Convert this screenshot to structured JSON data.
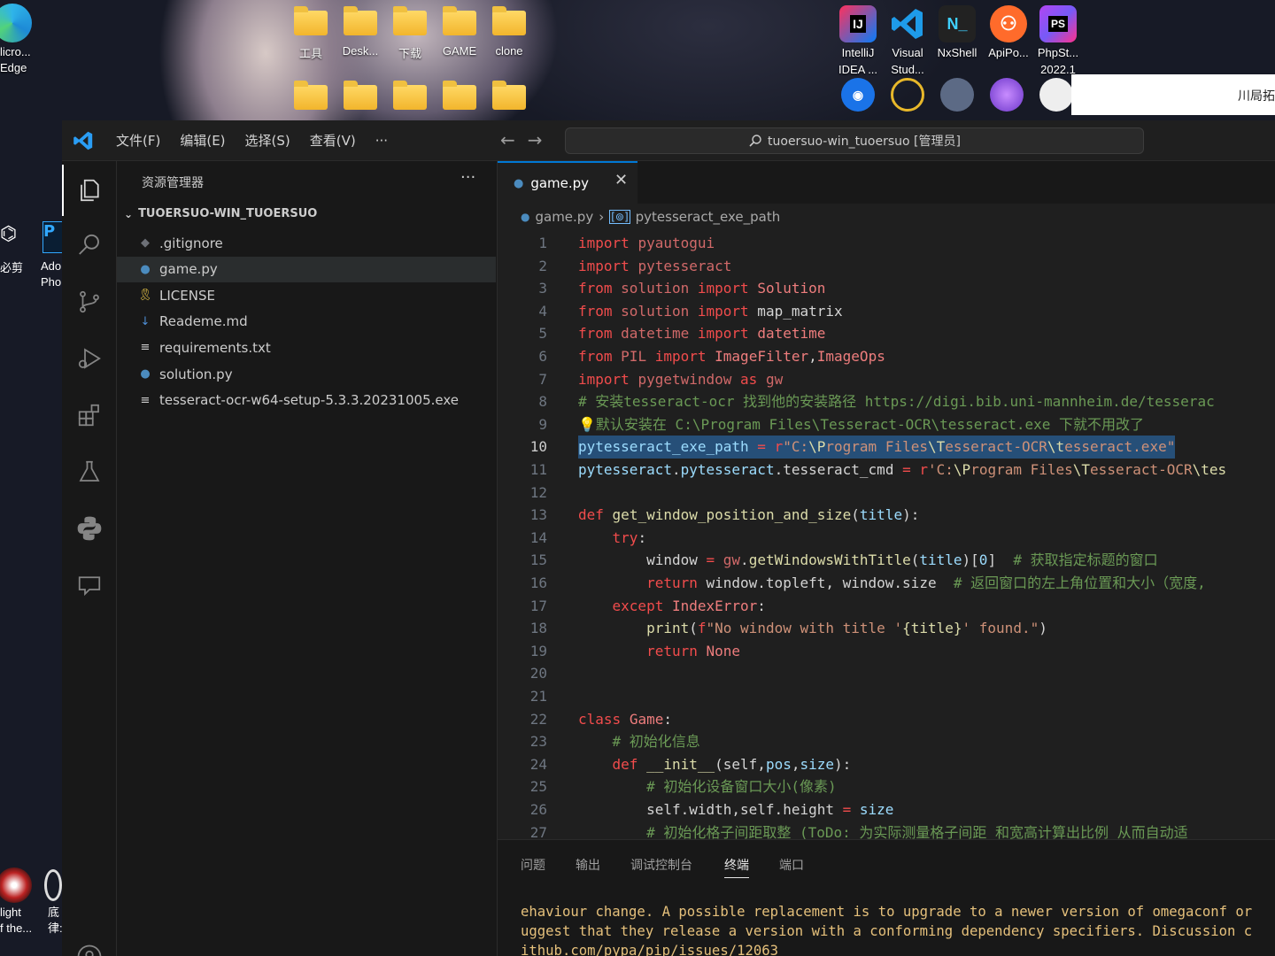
{
  "desktop": {
    "left_icons": [
      {
        "label1": "licro...",
        "label2": "Edge",
        "icon": "edge-icon"
      },
      {
        "label1": "必剪",
        "icon": "bijian-icon"
      },
      {
        "label1": "Ado",
        "label2": "Pho",
        "icon": "photoshop-icon"
      },
      {
        "label1": "light",
        "label2": "f the...",
        "icon": "game-icon"
      },
      {
        "label1": "底",
        "label2": "律:",
        "icon": "app-icon"
      }
    ],
    "folders_row1": [
      "工具",
      "Desk...",
      "下载",
      "GAME",
      "clone"
    ],
    "apps": [
      {
        "label1": "IntelliJ",
        "label2": "IDEA ...",
        "icon": "intellij-icon",
        "text": "IJ"
      },
      {
        "label1": "Visual",
        "label2": "Stud...",
        "icon": "visual-studio-icon",
        "text": ""
      },
      {
        "label1": "NxShell",
        "label2": "",
        "icon": "nxshell-icon",
        "text": "N_"
      },
      {
        "label1": "ApiPo...",
        "label2": "",
        "icon": "apipost-icon",
        "text": ""
      },
      {
        "label1": "PhpSt...",
        "label2": "2022.1",
        "icon": "phpstorm-icon",
        "text": "PS"
      }
    ],
    "notification_text": "川局拓"
  },
  "titlebar": {
    "menus": [
      "文件(F)",
      "编辑(E)",
      "选择(S)",
      "查看(V)",
      "···"
    ],
    "command_center": "tuoersuo-win_tuoersuo [管理员]"
  },
  "sidebar": {
    "title": "资源管理器",
    "more": "···",
    "project": "TUOERSUO-WIN_TUOERSUO",
    "files": [
      {
        "name": ".gitignore",
        "icon": "git-icon",
        "color": "#6d7077",
        "glyph": "◆"
      },
      {
        "name": "game.py",
        "icon": "python-icon",
        "color": "#4b8bbe",
        "glyph": "●",
        "selected": true
      },
      {
        "name": "LICENSE",
        "icon": "license-icon",
        "color": "#e8c547",
        "glyph": "🎗"
      },
      {
        "name": "Reademe.md",
        "icon": "markdown-icon",
        "color": "#4f8fd6",
        "glyph": "↓"
      },
      {
        "name": "requirements.txt",
        "icon": "text-file-icon",
        "color": "#cccccc",
        "glyph": "≡"
      },
      {
        "name": "solution.py",
        "icon": "python-icon",
        "color": "#4b8bbe",
        "glyph": "●"
      },
      {
        "name": "tesseract-ocr-w64-setup-5.3.3.20231005.exe",
        "icon": "text-file-icon",
        "color": "#cccccc",
        "glyph": "≡"
      }
    ]
  },
  "editor": {
    "tab": "game.py",
    "breadcrumb_file": "game.py",
    "breadcrumb_symbol": "pytesseract_exe_path",
    "current_line": 10,
    "lines": [
      {
        "n": "1",
        "seg": [
          [
            "kw",
            "import"
          ],
          [
            "pl",
            " "
          ],
          [
            "mod",
            "pyautogui"
          ]
        ]
      },
      {
        "n": "2",
        "seg": [
          [
            "kw",
            "import"
          ],
          [
            "pl",
            " "
          ],
          [
            "mod",
            "pytesseract"
          ]
        ]
      },
      {
        "n": "3",
        "seg": [
          [
            "kw",
            "from"
          ],
          [
            "pl",
            " "
          ],
          [
            "mod",
            "solution"
          ],
          [
            "pl",
            " "
          ],
          [
            "kw",
            "import"
          ],
          [
            "pl",
            " "
          ],
          [
            "cls",
            "Solution"
          ]
        ]
      },
      {
        "n": "4",
        "seg": [
          [
            "kw",
            "from"
          ],
          [
            "pl",
            " "
          ],
          [
            "mod",
            "solution"
          ],
          [
            "pl",
            " "
          ],
          [
            "kw",
            "import"
          ],
          [
            "pl",
            " map_matrix"
          ]
        ]
      },
      {
        "n": "5",
        "seg": [
          [
            "kw",
            "from"
          ],
          [
            "pl",
            " "
          ],
          [
            "mod",
            "datetime"
          ],
          [
            "pl",
            " "
          ],
          [
            "kw",
            "import"
          ],
          [
            "pl",
            " "
          ],
          [
            "cls",
            "datetime"
          ]
        ]
      },
      {
        "n": "6",
        "seg": [
          [
            "kw",
            "from"
          ],
          [
            "pl",
            " "
          ],
          [
            "mod",
            "PIL"
          ],
          [
            "pl",
            " "
          ],
          [
            "kw",
            "import"
          ],
          [
            "pl",
            " "
          ],
          [
            "cls",
            "ImageFilter"
          ],
          [
            "pl",
            ","
          ],
          [
            "cls",
            "ImageOps"
          ]
        ]
      },
      {
        "n": "7",
        "seg": [
          [
            "kw",
            "import"
          ],
          [
            "pl",
            " "
          ],
          [
            "mod",
            "pygetwindow"
          ],
          [
            "pl",
            " "
          ],
          [
            "kw",
            "as"
          ],
          [
            "pl",
            " "
          ],
          [
            "mod",
            "gw"
          ]
        ]
      },
      {
        "n": "8",
        "seg": [
          [
            "cm",
            "# 安装tesseract-ocr 找到他的安装路径 https://digi.bib.uni-mannheim.de/tesserac"
          ]
        ]
      },
      {
        "n": "9",
        "seg": [
          [
            "fn",
            "💡"
          ],
          [
            "cm",
            "默认安装在 C:\\Program Files\\Tesseract-OCR\\tesseract.exe 下就不用改了"
          ]
        ]
      },
      {
        "n": "10",
        "seg": [
          [
            "var",
            "pytesseract_exe_path"
          ],
          [
            "pl",
            " "
          ],
          [
            "kw",
            "="
          ],
          [
            "pl",
            " "
          ],
          [
            "kw",
            "r"
          ],
          [
            "str",
            "\"C:"
          ],
          [
            "fn",
            "\\P"
          ],
          [
            "str",
            "rogram Files"
          ],
          [
            "fn",
            "\\T"
          ],
          [
            "str",
            "esseract-OCR"
          ],
          [
            "fn",
            "\\t"
          ],
          [
            "str",
            "esseract.exe\""
          ]
        ]
      },
      {
        "n": "11",
        "seg": [
          [
            "var",
            "pytesseract"
          ],
          [
            "pl",
            "."
          ],
          [
            "var",
            "pytesseract"
          ],
          [
            "pl",
            "."
          ],
          [
            "pl",
            "tesseract_cmd"
          ],
          [
            "pl",
            " "
          ],
          [
            "kw",
            "="
          ],
          [
            "pl",
            " "
          ],
          [
            "kw",
            "r"
          ],
          [
            "str",
            "'C:"
          ],
          [
            "fn",
            "\\P"
          ],
          [
            "str",
            "rogram Files"
          ],
          [
            "fn",
            "\\T"
          ],
          [
            "str",
            "esseract-OCR"
          ],
          [
            "fn",
            "\\tes"
          ]
        ]
      },
      {
        "n": "12",
        "seg": []
      },
      {
        "n": "13",
        "seg": [
          [
            "kw",
            "def"
          ],
          [
            "pl",
            " "
          ],
          [
            "fn",
            "get_window_position_and_size"
          ],
          [
            "pl",
            "("
          ],
          [
            "var",
            "title"
          ],
          [
            "pl",
            "):"
          ]
        ]
      },
      {
        "n": "14",
        "seg": [
          [
            "pl",
            "    "
          ],
          [
            "kw",
            "try"
          ],
          [
            "pl",
            ":"
          ]
        ]
      },
      {
        "n": "15",
        "seg": [
          [
            "pl",
            "        window "
          ],
          [
            "kw",
            "="
          ],
          [
            "pl",
            " "
          ],
          [
            "mod",
            "gw"
          ],
          [
            "pl",
            "."
          ],
          [
            "fn",
            "getWindowsWithTitle"
          ],
          [
            "pl",
            "("
          ],
          [
            "var",
            "title"
          ],
          [
            "pl",
            ")["
          ],
          [
            "var",
            "0"
          ],
          [
            "pl",
            "]  "
          ],
          [
            "cm",
            "# 获取指定标题的窗口"
          ]
        ]
      },
      {
        "n": "16",
        "seg": [
          [
            "pl",
            "        "
          ],
          [
            "kw",
            "return"
          ],
          [
            "pl",
            " window.topleft, window.size  "
          ],
          [
            "cm",
            "# 返回窗口的左上角位置和大小（宽度,"
          ]
        ]
      },
      {
        "n": "17",
        "seg": [
          [
            "pl",
            "    "
          ],
          [
            "kw",
            "except"
          ],
          [
            "pl",
            " "
          ],
          [
            "cls",
            "IndexError"
          ],
          [
            "pl",
            ":"
          ]
        ]
      },
      {
        "n": "18",
        "seg": [
          [
            "pl",
            "        "
          ],
          [
            "fn",
            "print"
          ],
          [
            "pl",
            "("
          ],
          [
            "kw",
            "f"
          ],
          [
            "str",
            "\"No window with title '"
          ],
          [
            "fn",
            "{title}"
          ],
          [
            "str",
            "' found.\""
          ],
          [
            "pl",
            ")"
          ]
        ]
      },
      {
        "n": "19",
        "seg": [
          [
            "pl",
            "        "
          ],
          [
            "kw",
            "return"
          ],
          [
            "pl",
            " "
          ],
          [
            "cls",
            "None"
          ]
        ]
      },
      {
        "n": "20",
        "seg": []
      },
      {
        "n": "21",
        "seg": []
      },
      {
        "n": "22",
        "seg": [
          [
            "kw",
            "class"
          ],
          [
            "pl",
            " "
          ],
          [
            "cls",
            "Game"
          ],
          [
            "pl",
            ":"
          ]
        ]
      },
      {
        "n": "23",
        "seg": [
          [
            "pl",
            "    "
          ],
          [
            "cm",
            "# 初始化信息"
          ]
        ]
      },
      {
        "n": "24",
        "seg": [
          [
            "pl",
            "    "
          ],
          [
            "kw",
            "def"
          ],
          [
            "pl",
            " "
          ],
          [
            "fn",
            "__init__"
          ],
          [
            "pl",
            "(self,"
          ],
          [
            "var",
            "pos"
          ],
          [
            "pl",
            ","
          ],
          [
            "var",
            "size"
          ],
          [
            "pl",
            "):"
          ]
        ]
      },
      {
        "n": "25",
        "seg": [
          [
            "pl",
            "        "
          ],
          [
            "cm",
            "# 初始化设备窗口大小(像素)"
          ]
        ]
      },
      {
        "n": "26",
        "seg": [
          [
            "pl",
            "        self.width,self.height "
          ],
          [
            "kw",
            "="
          ],
          [
            "pl",
            " "
          ],
          [
            "var",
            "size"
          ]
        ]
      },
      {
        "n": "27",
        "seg": [
          [
            "pl",
            "        "
          ],
          [
            "cm",
            "# 初始化格子间距取整 (ToDo: 为实际测量格子间距 和宽高计算出比例 从而自动适"
          ]
        ]
      }
    ]
  },
  "panel": {
    "tabs": [
      "问题",
      "输出",
      "调试控制台",
      "终端",
      "端口"
    ],
    "active_tab": 3,
    "terminal_lines": [
      "ehaviour change. A possible replacement is to upgrade to a newer version of omegaconf or",
      "uggest that they release a version with a conforming dependency specifiers. Discussion c",
      "ithub.com/pypa/pip/issues/12063"
    ]
  }
}
